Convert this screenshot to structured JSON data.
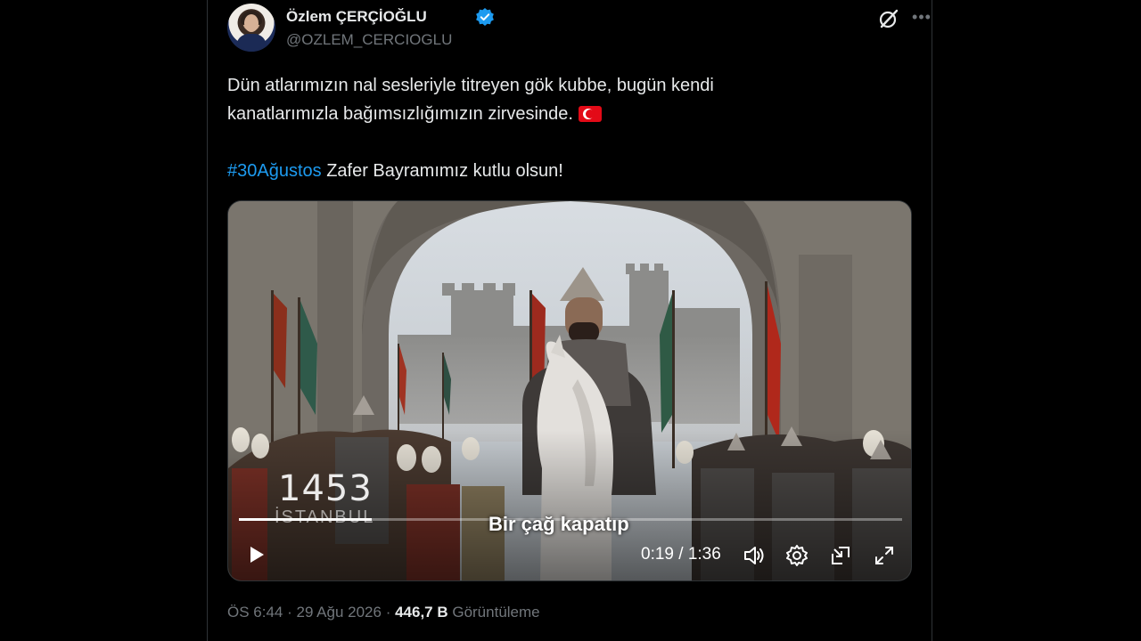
{
  "author": {
    "display_name": "Özlem ÇERÇİOĞLU",
    "handle": "@OZLEM_CERCIOGLU",
    "verified": true,
    "verified_color": "#1d9bf0"
  },
  "tweet": {
    "line1": "Dün atlarımızın nal sesleriyle titreyen gök kubbe, bugün kendi",
    "line2": "kanatlarımızla bağımsızlığımızın zirvesinde.",
    "hashtag": "#30Ağustos",
    "line3_rest": " Zafer Bayramımız kutlu olsun!",
    "hashtag_color": "#1d9bf0",
    "flag_emoji": "turkish-flag"
  },
  "video": {
    "watermark_number": "1453",
    "watermark_city": "İSTANBUL",
    "subtitle": "Bir çağ kapatıp",
    "current_time": "0:19",
    "separator": " / ",
    "duration": "1:36",
    "progress_fraction": 0.2,
    "icons": [
      "play-icon",
      "volume-icon",
      "settings-icon",
      "pip-icon",
      "fullscreen-icon"
    ]
  },
  "meta": {
    "time": "ÖS 6:44",
    "sep": " · ",
    "date": "29 Ağu 2026",
    "sep2": " · ",
    "views_count": "446,7 B",
    "views_label": " Görüntüleme"
  }
}
